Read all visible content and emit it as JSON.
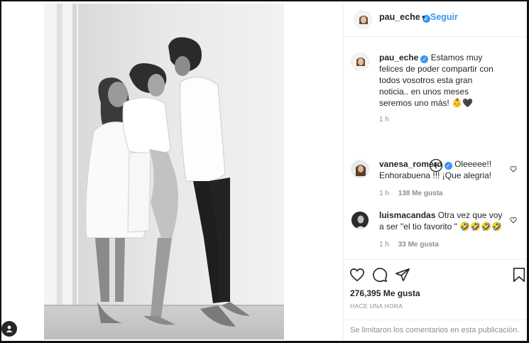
{
  "post": {
    "username": "pau_eche",
    "separator": "•",
    "follow_label": "Seguir",
    "verified_glyph": "✓",
    "caption": "Estamos muy felices de poder compartir con todos vosotros esta gran noticia.. en unos meses seremos uno más! 👶🖤",
    "caption_time": "1 h",
    "likes": "276,395 Me gusta",
    "time_ago": "HACE UNA HORA",
    "comments_closed": "Se limitaron los comentarios en esta publicación."
  },
  "comments": [
    {
      "username": "vanesa_romero",
      "text": "Oleeeee!! Enhorabuena !!! ¡Que alegria!",
      "time": "1 h",
      "likes": "138 Me gusta"
    },
    {
      "username": "luismacandas",
      "text": "Otra vez que voy a ser \"el tio favorito \" 🤣🤣🤣🤣",
      "time": "1 h",
      "likes": "33 Me gusta"
    }
  ],
  "icons": {
    "like": "heart-icon",
    "comment": "comment-icon",
    "share": "share-icon",
    "save": "bookmark-icon",
    "load_more": "plus-circle-icon"
  },
  "colors": {
    "link_blue": "#3897f0",
    "muted": "#8e8e8e",
    "text": "#262626"
  }
}
